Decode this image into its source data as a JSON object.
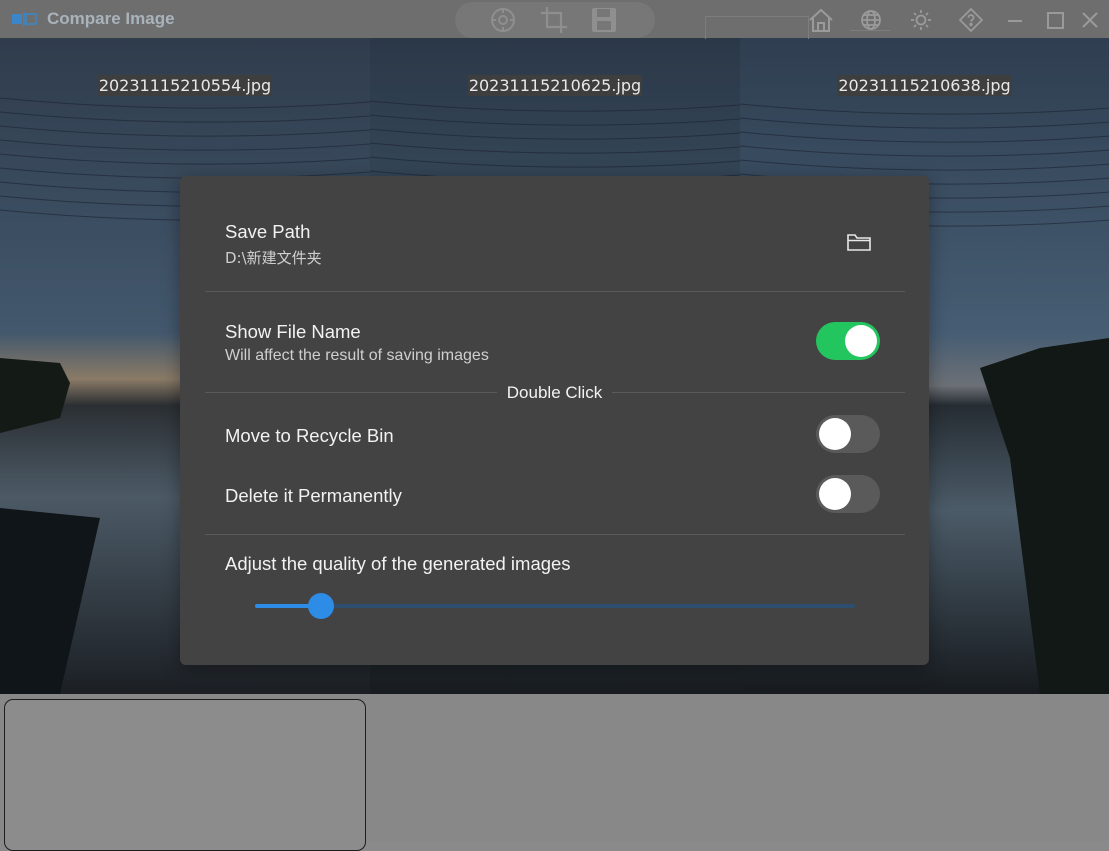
{
  "titlebar": {
    "title": "Compare Image",
    "toolbar_icons": [
      "settings-gear-icon",
      "crop-icon",
      "save-icon"
    ],
    "window_icons": [
      "home-icon",
      "globe-icon",
      "sun-icon",
      "help-diamond-icon",
      "minimize-icon",
      "maximize-icon",
      "close-icon"
    ]
  },
  "images": [
    {
      "filename": "20231115210554.jpg"
    },
    {
      "filename": "20231115210625.jpg"
    },
    {
      "filename": "20231115210638.jpg"
    }
  ],
  "dialog": {
    "save_path": {
      "title": "Save Path",
      "value": "D:\\新建文件夹",
      "icon": "folder-icon"
    },
    "show_file_name": {
      "title": "Show File Name",
      "subtitle": "Will affect the result of saving images",
      "enabled": true
    },
    "double_click_section": "Double Click",
    "move_to_recycle_bin": {
      "title": "Move to Recycle Bin",
      "enabled": false
    },
    "delete_permanently": {
      "title": "Delete it Permanently",
      "enabled": false
    },
    "quality": {
      "title": "Adjust the quality of the generated images",
      "value_fraction": 0.11
    }
  },
  "colors": {
    "accent_blue": "#2d8ce6",
    "toggle_on": "#22c55e",
    "dialog_bg": "#434343"
  }
}
